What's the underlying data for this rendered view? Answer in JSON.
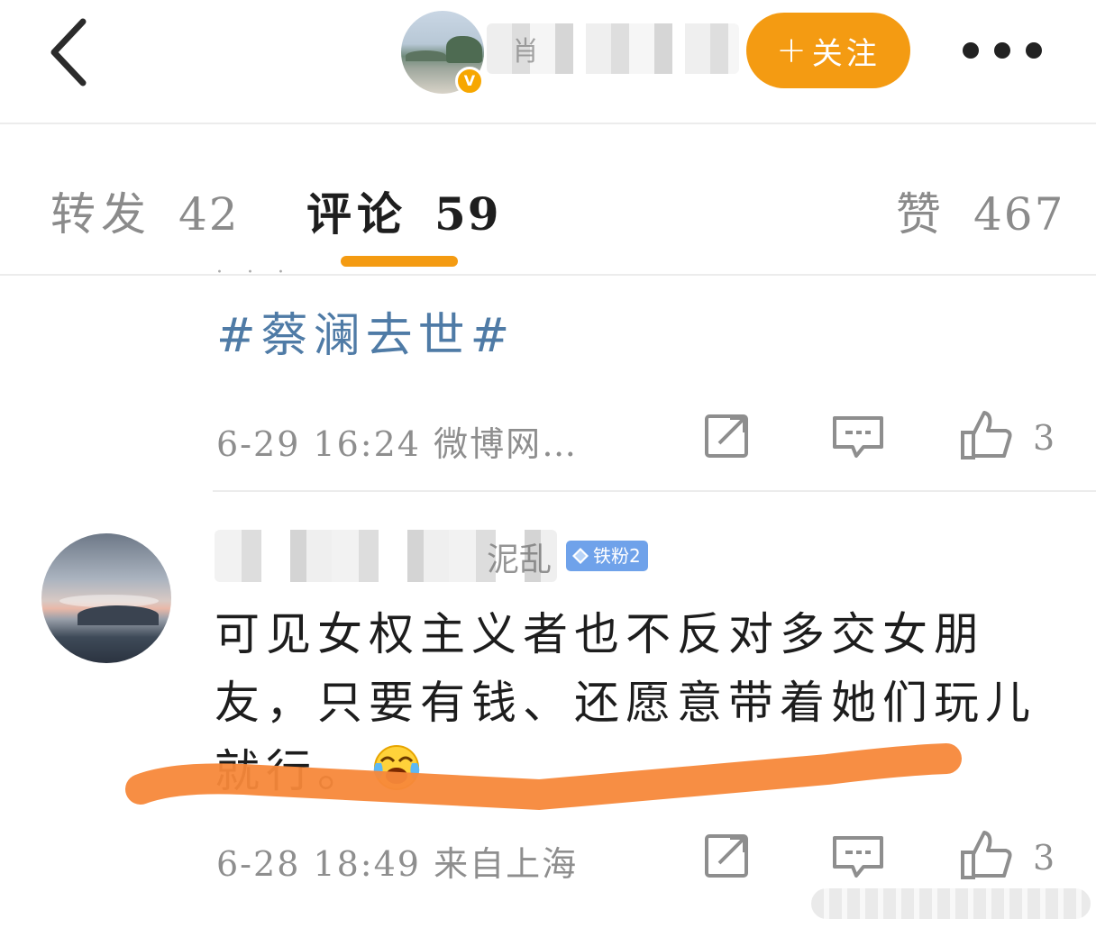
{
  "header": {
    "back_icon": "chevron-left-icon",
    "verified_badge": "V",
    "username_fragment": "肖",
    "follow_label": "关注",
    "follow_plus": "+",
    "more_icon": "more-dots-icon",
    "accent_color": "#f49b12"
  },
  "tabs": {
    "repost": {
      "label": "转发",
      "count": "42"
    },
    "comment": {
      "label": "评论",
      "count": "59",
      "active": true
    },
    "like": {
      "label": "赞",
      "count": "467"
    }
  },
  "previous_comment": {
    "hashtag": "#蔡澜去世#",
    "time": "6-29  16:24",
    "source": "微博网…",
    "like_count": "3",
    "cutoff_text": "· · ·"
  },
  "comment": {
    "username_fragment": "泥乱",
    "fan_badge": "铁粉2",
    "text": "可见女权主义者也不反对多交女朋友，只要有钱、还愿意带着她们玩儿就行。",
    "emoji": "laughing-crying-emoji",
    "time": "6-28  18:49",
    "source": "来自上海",
    "like_count": "3",
    "highlight_color": "#f7883a"
  },
  "icons": {
    "share": "share-icon",
    "comment": "comment-icon",
    "like": "thumbs-up-icon"
  }
}
